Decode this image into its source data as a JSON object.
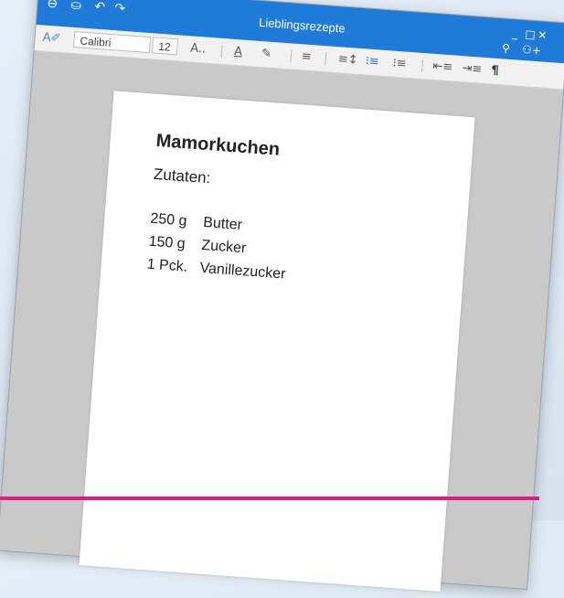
{
  "window": {
    "title": "Lieblingsrezepte",
    "titlebar_color": "#1f7ad8",
    "left_icons": [
      "back-icon",
      "save-icon",
      "undo-icon",
      "redo-icon"
    ],
    "right_icons": [
      "search-icon",
      "share-person-icon"
    ],
    "controls": [
      "minimize",
      "maximize",
      "close"
    ]
  },
  "toolbar": {
    "font_name": "Calibri",
    "font_size": "12",
    "font_size_label": "A..",
    "font_color_label": "A",
    "paragraph_mark": "¶"
  },
  "document": {
    "heading": "Mamorkuchen",
    "subheading": "Zutaten:",
    "ingredients": [
      {
        "qty": "250 g",
        "name": "Butter"
      },
      {
        "qty": "150 g",
        "name": "Zucker"
      },
      {
        "qty": "1 Pck.",
        "name": "Vanillezucker"
      }
    ]
  },
  "accent_line_color": "#e01c7e"
}
